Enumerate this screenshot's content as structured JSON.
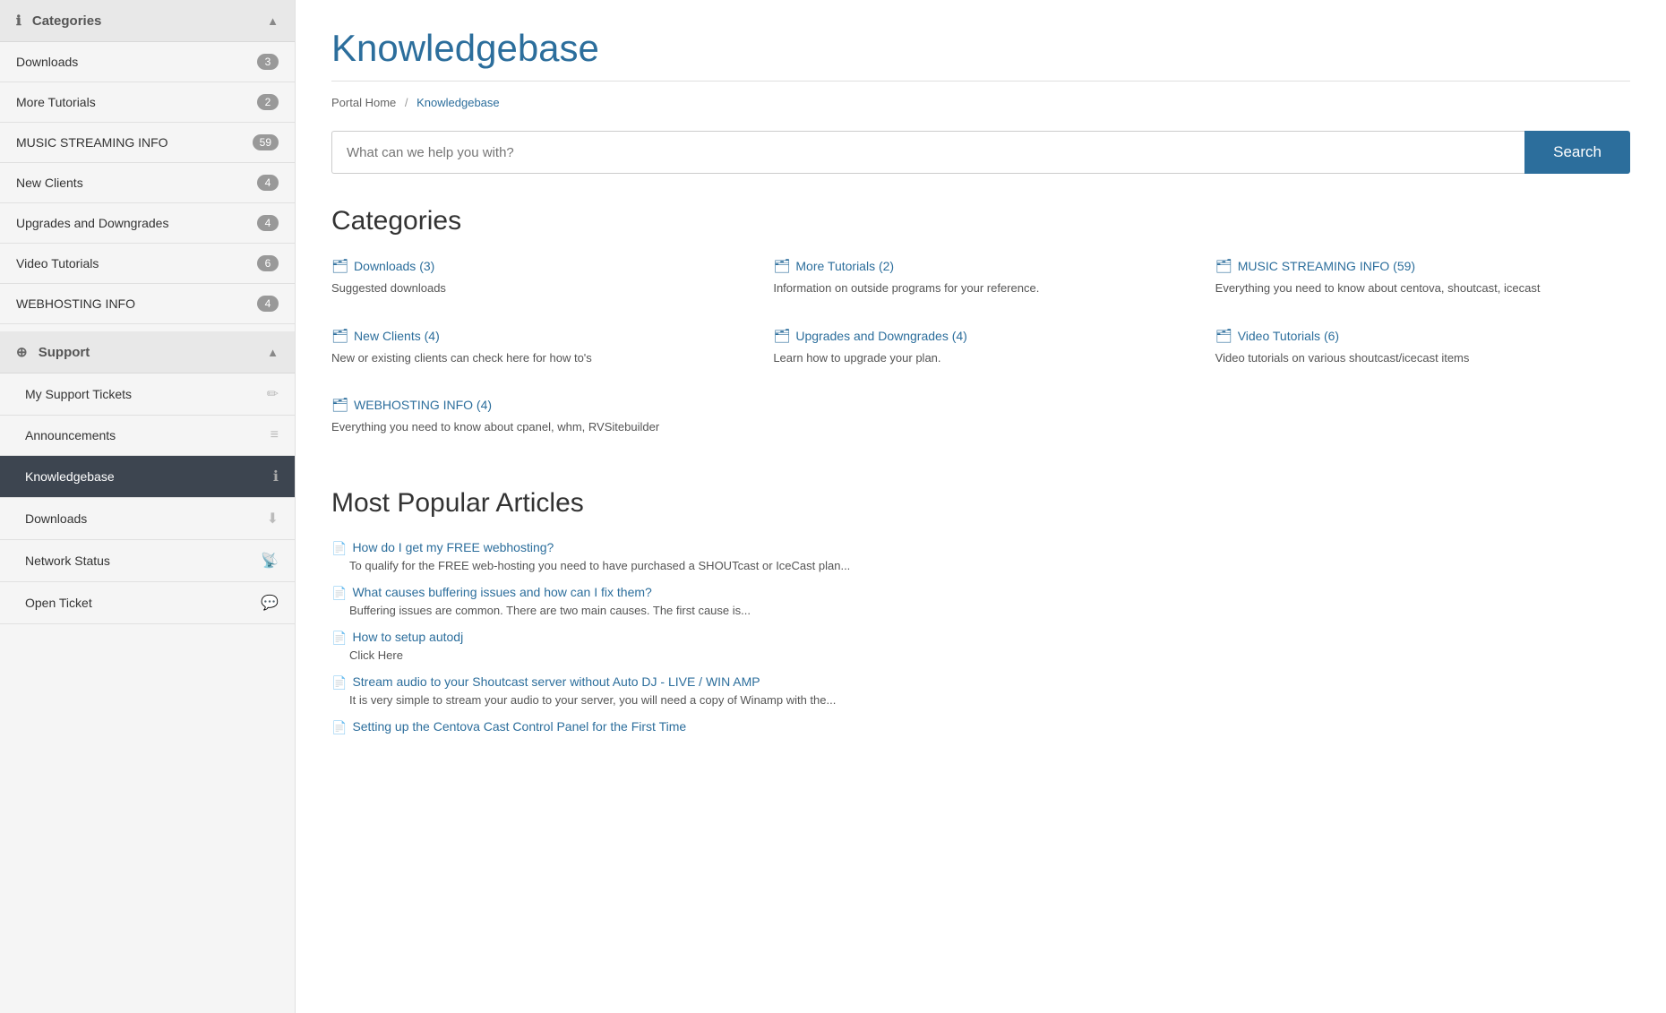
{
  "sidebar": {
    "categories_header": "Categories",
    "info_icon": "ℹ",
    "chevron": "▲",
    "items": [
      {
        "label": "Downloads",
        "badge": "3"
      },
      {
        "label": "More Tutorials",
        "badge": "2"
      },
      {
        "label": "MUSIC STREAMING INFO",
        "badge": "59"
      },
      {
        "label": "New Clients",
        "badge": "4"
      },
      {
        "label": "Upgrades and Downgrades",
        "badge": "4"
      },
      {
        "label": "Video Tutorials",
        "badge": "6"
      },
      {
        "label": "WEBHOSTING INFO",
        "badge": "4"
      }
    ],
    "support_header": "Support",
    "support_icon": "⊕",
    "support_items": [
      {
        "label": "My Support Tickets",
        "icon": "✏",
        "active": false
      },
      {
        "label": "Announcements",
        "icon": "≡",
        "active": false
      },
      {
        "label": "Knowledgebase",
        "icon": "ℹ",
        "active": true
      },
      {
        "label": "Downloads",
        "icon": "⬇",
        "active": false
      },
      {
        "label": "Network Status",
        "icon": "📡",
        "active": false
      },
      {
        "label": "Open Ticket",
        "icon": "💬",
        "active": false
      }
    ]
  },
  "main": {
    "page_title": "Knowledgebase",
    "breadcrumb": {
      "home": "Portal Home",
      "sep": "/",
      "current": "Knowledgebase"
    },
    "search": {
      "placeholder": "What can we help you with?",
      "button_label": "Search"
    },
    "categories_title": "Categories",
    "categories": [
      {
        "link": "Downloads (3)",
        "desc": "Suggested downloads"
      },
      {
        "link": "More Tutorials (2)",
        "desc": "Information on outside programs for your reference."
      },
      {
        "link": "MUSIC STREAMING INFO (59)",
        "desc": "Everything you need to know about centova, shoutcast, icecast"
      },
      {
        "link": "New Clients (4)",
        "desc": "New or existing clients can check here for how to's"
      },
      {
        "link": "Upgrades and Downgrades (4)",
        "desc": "Learn how to upgrade your plan."
      },
      {
        "link": "Video Tutorials (6)",
        "desc": "Video tutorials on various shoutcast/icecast items"
      },
      {
        "link": "WEBHOSTING INFO (4)",
        "desc": "Everything you need to know about cpanel, whm, RVSitebuilder"
      }
    ],
    "popular_title": "Most Popular Articles",
    "articles": [
      {
        "link": "How do I get my FREE webhosting?",
        "desc": "To qualify for the FREE web-hosting you need to have purchased a SHOUTcast or IceCast plan..."
      },
      {
        "link": "What causes buffering issues and how can I fix them?",
        "desc": "Buffering  issues are common.  There are two main causes.  The first cause is..."
      },
      {
        "link": "How to setup autodj",
        "desc": "Click Here"
      },
      {
        "link": "Stream audio to your Shoutcast server without Auto DJ - LIVE / WIN AMP",
        "desc": "It is very simple to stream your audio to your server, you will need a copy of Winamp with the..."
      },
      {
        "link": "Setting up the Centova Cast Control Panel for the First Time",
        "desc": ""
      }
    ]
  }
}
